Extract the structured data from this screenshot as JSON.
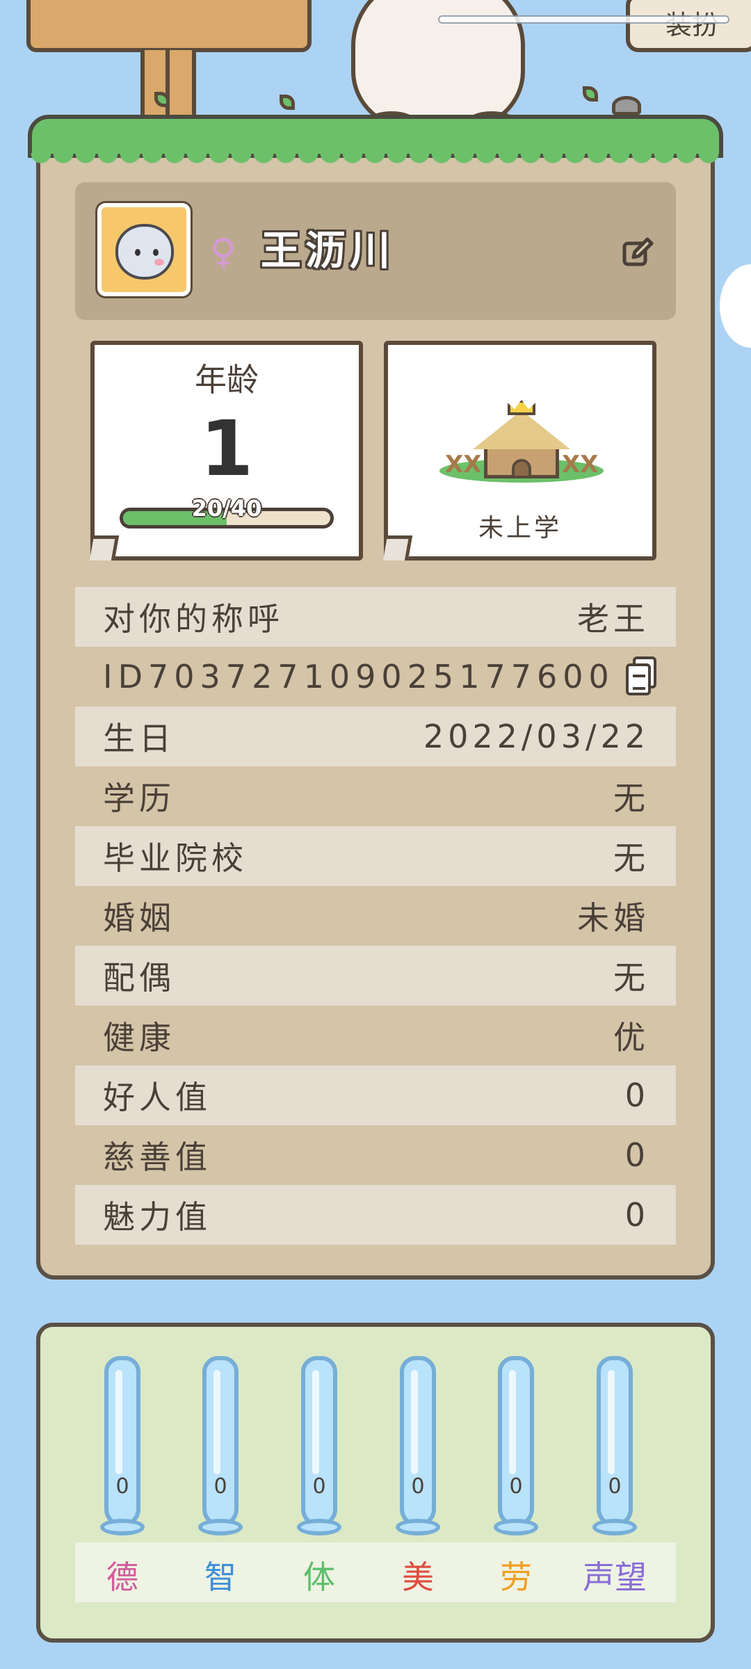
{
  "top": {
    "dress_button": "装扮"
  },
  "profile": {
    "gender_symbol": "♀",
    "name": "王沥川"
  },
  "age_panel": {
    "title": "年龄",
    "age": "1",
    "progress_text": "20/40",
    "progress_fraction": 0.5
  },
  "school_panel": {
    "status": "未上学"
  },
  "info_rows": [
    {
      "label": "对你的称呼",
      "value": "老王"
    },
    {
      "label": "ID",
      "value": "703727109025177600"
    },
    {
      "label": "生日",
      "value": "2022/03/22"
    },
    {
      "label": "学历",
      "value": "无"
    },
    {
      "label": "毕业院校",
      "value": "无"
    },
    {
      "label": "婚姻",
      "value": "未婚"
    },
    {
      "label": "配偶",
      "value": "无"
    },
    {
      "label": "健康",
      "value": "优"
    },
    {
      "label": "好人值",
      "value": "0"
    },
    {
      "label": "慈善值",
      "value": "0"
    },
    {
      "label": "魅力值",
      "value": "0"
    }
  ],
  "attributes": [
    {
      "label": "德",
      "value": "0",
      "color": "#d35a9c"
    },
    {
      "label": "智",
      "value": "0",
      "color": "#3f8fd8"
    },
    {
      "label": "体",
      "value": "0",
      "color": "#5cbf6a"
    },
    {
      "label": "美",
      "value": "0",
      "color": "#e04a3c"
    },
    {
      "label": "劳",
      "value": "0",
      "color": "#f0a023"
    },
    {
      "label": "声望",
      "value": "0",
      "color": "#8a6ed6"
    }
  ]
}
